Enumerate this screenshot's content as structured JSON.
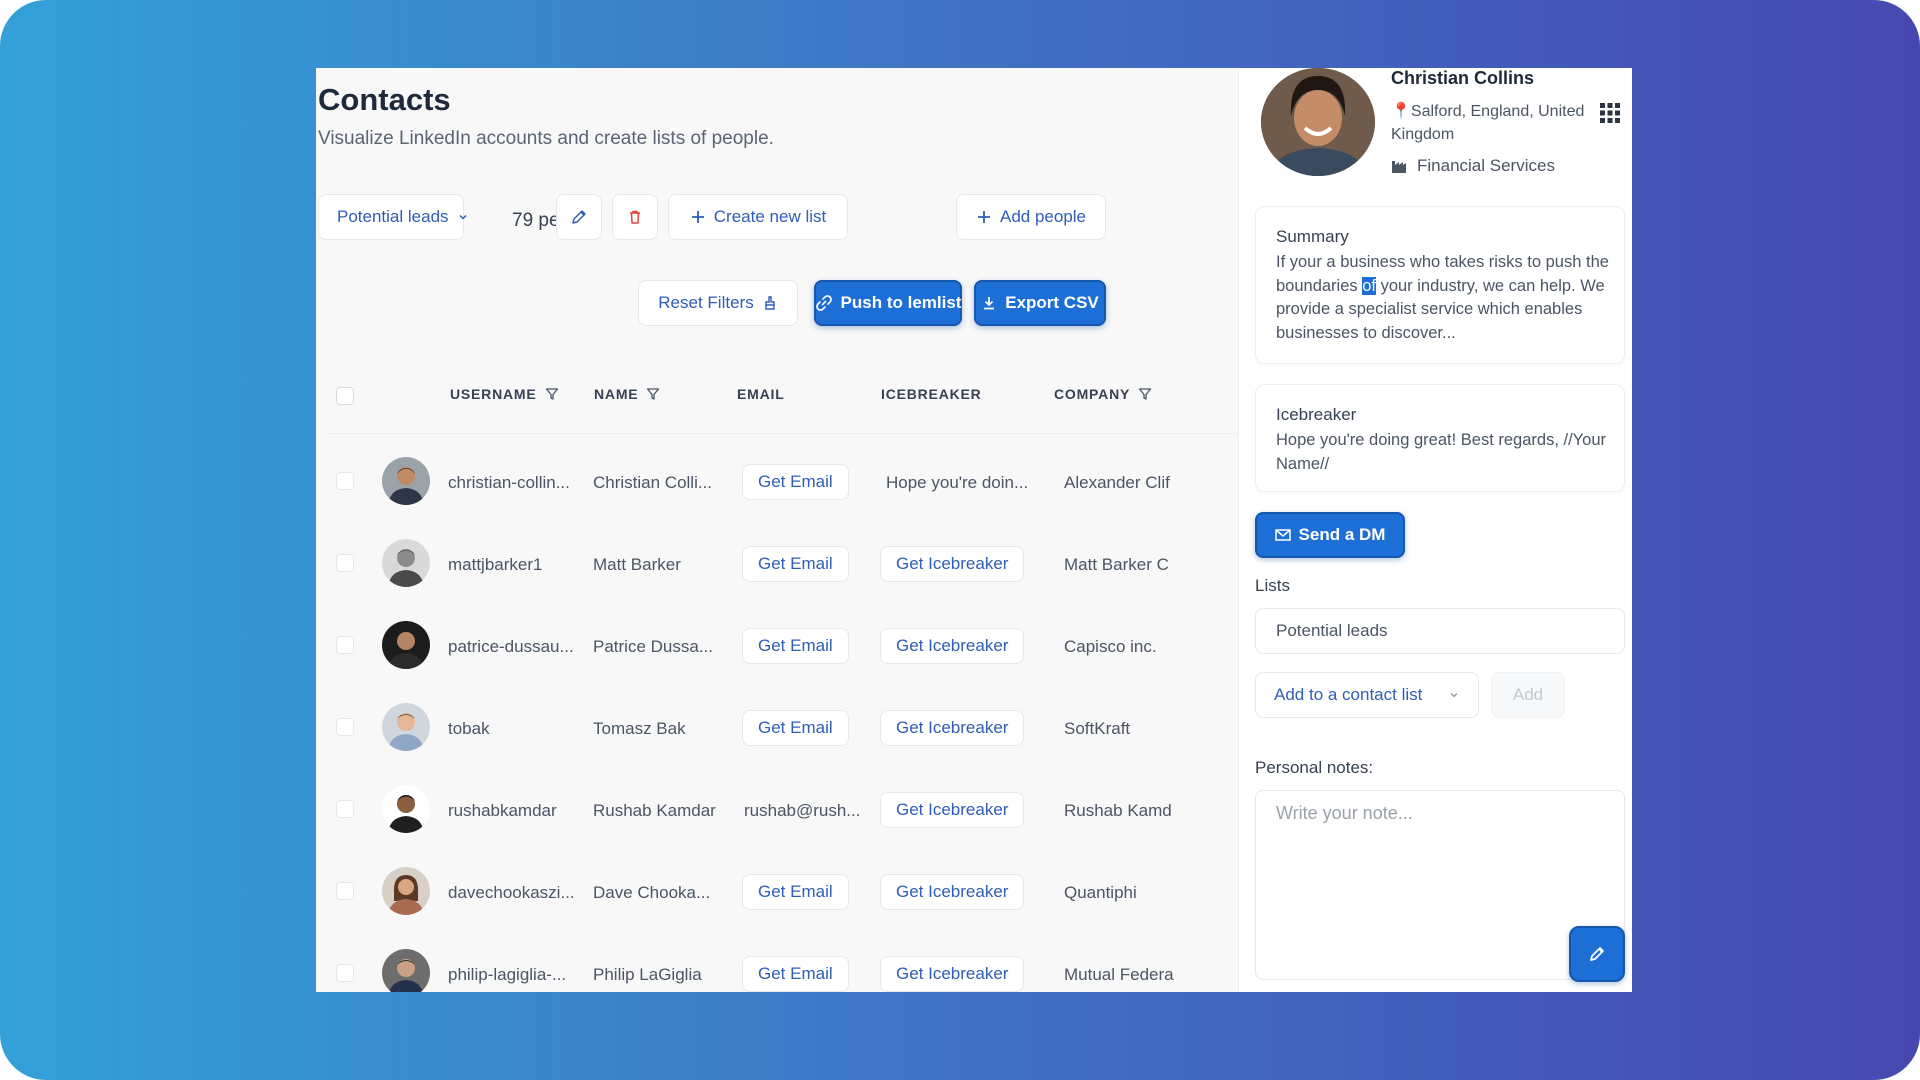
{
  "header": {
    "title": "Contacts",
    "subtitle": "Visualize LinkedIn accounts and create lists of people."
  },
  "toolbar": {
    "list_select": "Potential leads",
    "people_count": "79 people",
    "create_list": "Create new list",
    "add_people": "Add people",
    "reset_filters": "Reset Filters",
    "push_to_lemlist": "Push to lemlist",
    "export_csv": "Export CSV"
  },
  "table": {
    "columns": {
      "username": "USERNAME",
      "name": "NAME",
      "email": "EMAIL",
      "icebreaker": "ICEBREAKER",
      "company": "COMPANY"
    },
    "rows": [
      {
        "username": "christian-collin...",
        "name": "Christian Colli...",
        "email": "Get Email",
        "icebreaker": "Hope you're doin...",
        "company": "Alexander Clif"
      },
      {
        "username": "mattjbarker1",
        "name": "Matt Barker",
        "email": "Get Email",
        "icebreaker": "Get Icebreaker",
        "company": "Matt Barker C"
      },
      {
        "username": "patrice-dussau...",
        "name": "Patrice Dussa...",
        "email": "Get Email",
        "icebreaker": "Get Icebreaker",
        "company": "Capisco inc."
      },
      {
        "username": "tobak",
        "name": "Tomasz Bak",
        "email": "Get Email",
        "icebreaker": "Get Icebreaker",
        "company": "SoftKraft"
      },
      {
        "username": "rushabkamdar",
        "name": "Rushab Kamdar",
        "email": "rushab@rush...",
        "icebreaker": "Get Icebreaker",
        "company": "Rushab Kamd"
      },
      {
        "username": "davechookaszi...",
        "name": "Dave Chooka...",
        "email": "Get Email",
        "icebreaker": "Get Icebreaker",
        "company": "Quantiphi"
      },
      {
        "username": "philip-lagiglia-...",
        "name": "Philip LaGiglia",
        "email": "Get Email",
        "icebreaker": "Get Icebreaker",
        "company": "Mutual Federa"
      }
    ]
  },
  "profile": {
    "name": "Christian Collins",
    "location": "Salford, England, United Kingdom",
    "industry": "Financial Services",
    "summary_title": "Summary",
    "summary_before": "If your a business who takes risks to push the boundaries ",
    "summary_highlight": "of",
    "summary_after": " your industry, we can help. We provide a specialist service which enables businesses to discover...",
    "icebreaker_title": "Icebreaker",
    "icebreaker_text": "Hope you're doing great! Best regards, //Your Name//",
    "send_dm": "Send a DM",
    "lists_label": "Lists",
    "current_list": "Potential leads",
    "add_to_list": "Add to a contact list",
    "add_button": "Add",
    "notes_label": "Personal notes:",
    "notes_placeholder": "Write your note..."
  },
  "colors": {
    "accent": "#1d6fd6",
    "link": "#2f5db8",
    "background_gradient_start": "#33a0d8",
    "background_gradient_end": "#4648b0"
  }
}
